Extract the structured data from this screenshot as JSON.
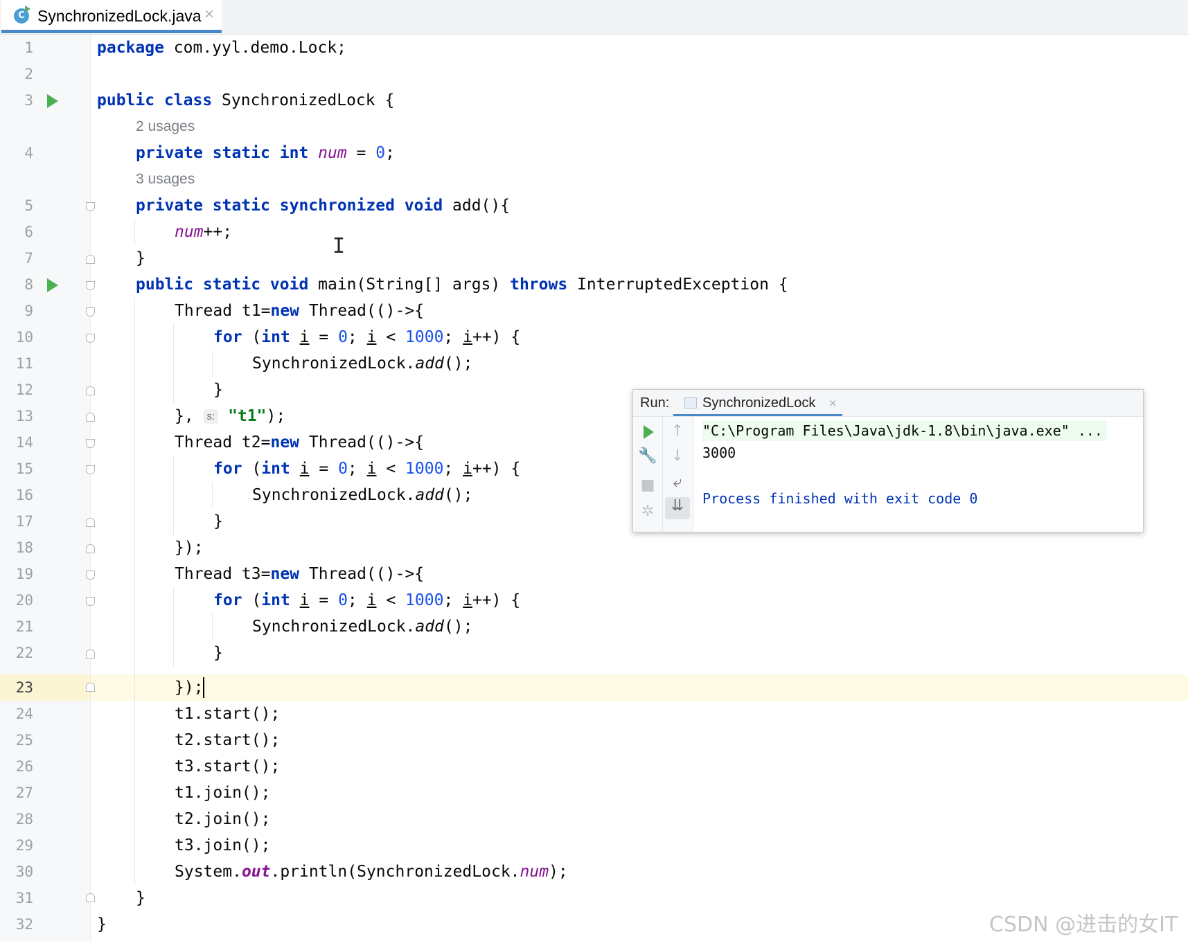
{
  "tab": {
    "title": "SynchronizedLock.java",
    "icon": "C",
    "close": "×"
  },
  "line_numbers": [
    "1",
    "2",
    "3",
    "4",
    "5",
    "6",
    "7",
    "8",
    "9",
    "10",
    "11",
    "12",
    "13",
    "14",
    "15",
    "16",
    "17",
    "18",
    "19",
    "20",
    "21",
    "22",
    "23",
    "24",
    "25",
    "26",
    "27",
    "28",
    "29",
    "30",
    "31",
    "32"
  ],
  "hints": {
    "usages_num": "2 usages",
    "usages_add": "3 usages"
  },
  "code": {
    "l1": [
      "package",
      " com.yyl.demo.Lock;"
    ],
    "l3": [
      "public",
      " ",
      "class",
      " SynchronizedLock {"
    ],
    "l4": [
      "private",
      " ",
      "static",
      " ",
      "int",
      " ",
      "num",
      " = ",
      "0",
      ";"
    ],
    "l5": [
      "private",
      " ",
      "static",
      " ",
      "synchronized",
      " ",
      "void",
      " add(){"
    ],
    "l6": [
      "num",
      "++;"
    ],
    "l7": "}",
    "l8": [
      "public",
      " ",
      "static",
      " ",
      "void",
      " main(String[] args) ",
      "throws",
      " InterruptedException {"
    ],
    "t1": [
      "Thread t1=",
      "new",
      " Thread(()->{"
    ],
    "t2": [
      "Thread t2=",
      "new",
      " Thread(()->{"
    ],
    "t3": [
      "Thread t3=",
      "new",
      " Thread(()->{"
    ],
    "for": [
      "for",
      " (",
      "int",
      " ",
      "i",
      " = ",
      "0",
      "; ",
      "i",
      " < ",
      "1000",
      "; ",
      "i",
      "++) {"
    ],
    "call": [
      "SynchronizedLock.",
      "add",
      "();"
    ],
    "close_brace": "}",
    "l13": [
      "},",
      "s:",
      "\"t1\"",
      ");"
    ],
    "close_paren": "});",
    "starts": [
      "t1.start();",
      "t2.start();",
      "t3.start();"
    ],
    "joins": [
      "t1.join();",
      "t2.join();",
      "t3.join();"
    ],
    "println": [
      "System.",
      "out",
      ".println(SynchronizedLock.",
      "num",
      ");"
    ],
    "l31": "}",
    "l32": "}"
  },
  "run_window": {
    "label": "Run:",
    "tab_title": "SynchronizedLock",
    "tab_close": "×",
    "console": [
      "\"C:\\Program Files\\Java\\jdk-1.8\\bin\\java.exe\" ...",
      "3000",
      "Process finished with exit code 0"
    ],
    "icons": [
      "rerun-icon",
      "wrench-icon",
      "stop-icon",
      "debug-icon",
      "up-arrow-icon",
      "down-arrow-icon",
      "soft-wrap-icon",
      "scroll-to-end-icon"
    ]
  },
  "watermark": "CSDN @进击的女IT",
  "colors": {
    "keyword": "#0033b3",
    "number": "#1750eb",
    "field": "#871094",
    "string": "#067d17",
    "accent": "#4a88c7",
    "run": "#4caf50"
  }
}
